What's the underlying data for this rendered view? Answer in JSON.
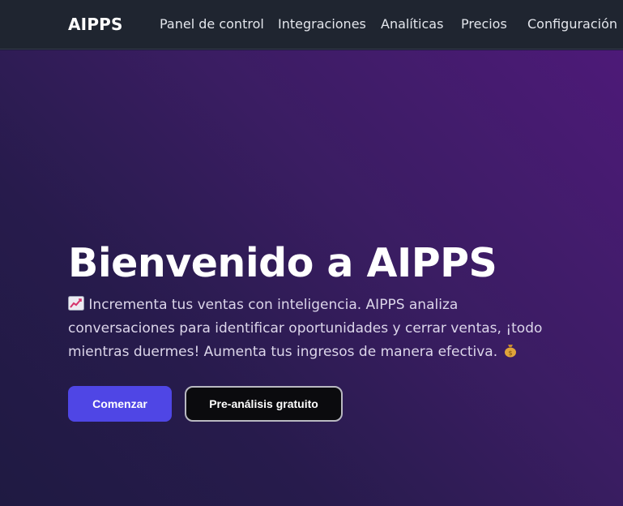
{
  "nav": {
    "brand": "AIPPS",
    "links": [
      "Panel de control",
      "Integraciones",
      "Analíticas",
      "Precios",
      "Configuración"
    ]
  },
  "hero": {
    "title": "Bienvenido a AIPPS",
    "description_part1": "Incrementa tus ventas con inteligencia. AIPPS analiza conversaciones para identificar oportunidades y cerrar ventas, ¡todo mientras duermes! Aumenta tus ingresos de manera efectiva.",
    "icons": [
      "chart-increasing-icon",
      "money-bag-icon"
    ],
    "primary_button": "Comenzar",
    "secondary_button": "Pre-análisis gratuito"
  },
  "colors": {
    "navbar": "#1f2530",
    "accent": "#4f46e5",
    "hero_gradient_start": "#4d1a78",
    "hero_gradient_end": "#1f1a42"
  }
}
